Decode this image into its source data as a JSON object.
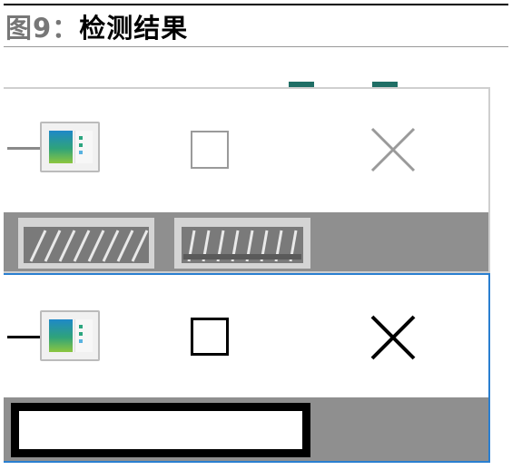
{
  "caption": {
    "label": "图9：",
    "title": "检测结果"
  },
  "colors": {
    "header_rule": "#000000",
    "selection_border": "#2a7fd0",
    "strip": "#8f8f8f",
    "taskbar_tab": "#1f6e65"
  },
  "panels": [
    {
      "state": "original",
      "icons": [
        "window-thumbnail-icon",
        "maximize-icon",
        "close-icon"
      ],
      "strip_content": [
        "blurred-thumbnail-1",
        "blurred-thumbnail-2"
      ]
    },
    {
      "state": "detected",
      "icons": [
        "window-thumbnail-icon",
        "maximize-icon",
        "close-icon"
      ],
      "strip_content": [
        "detection-box"
      ]
    }
  ]
}
